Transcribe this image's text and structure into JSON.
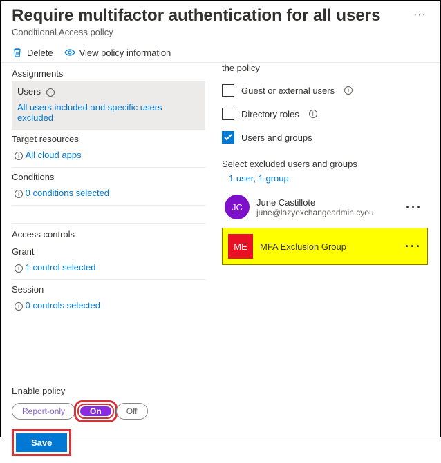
{
  "header": {
    "title": "Require multifactor authentication for all users",
    "subtitle": "Conditional Access policy"
  },
  "toolbar": {
    "delete": "Delete",
    "view_info": "View policy information"
  },
  "left": {
    "assignments": "Assignments",
    "users_label": "Users",
    "users_value": "All users included and specific users excluded",
    "target_label": "Target resources",
    "target_value": "All cloud apps",
    "conditions_label": "Conditions",
    "conditions_value": "0 conditions selected",
    "access_controls": "Access controls",
    "grant_label": "Grant",
    "grant_value": "1 control selected",
    "session_label": "Session",
    "session_value": "0 controls selected"
  },
  "right": {
    "top_text": "the policy",
    "guest": "Guest or external users",
    "directory_roles": "Directory roles",
    "users_groups": "Users and groups",
    "select_excluded": "Select excluded users and groups",
    "excluded_count": "1 user, 1 group",
    "user1": {
      "initials": "JC",
      "name": "June Castillote",
      "email": "june@lazyexchangeadmin.cyou"
    },
    "user2": {
      "initials": "ME",
      "name": "MFA Exclusion Group"
    }
  },
  "footer": {
    "enable_label": "Enable policy",
    "report_only": "Report-only",
    "on": "On",
    "off": "Off",
    "save": "Save"
  },
  "info_glyph": "i"
}
